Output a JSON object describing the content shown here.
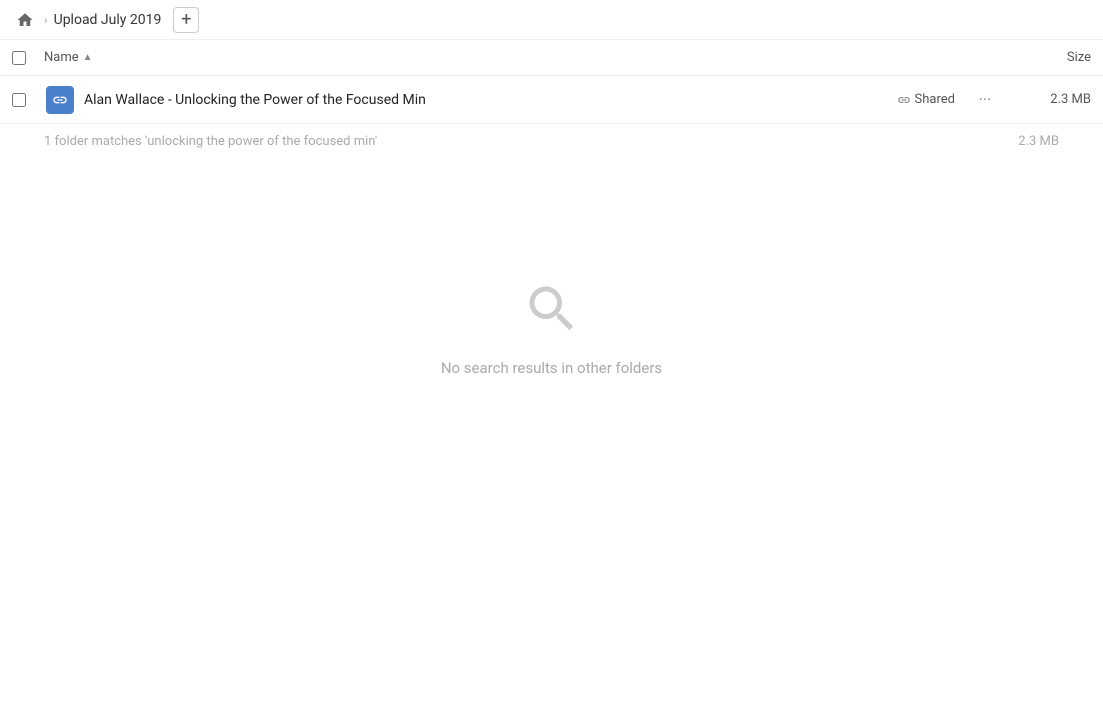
{
  "breadcrumb": {
    "home_label": "Home",
    "current_folder": "Upload July 2019",
    "add_button_label": "+"
  },
  "column_headers": {
    "name_label": "Name",
    "sort_indicator": "▲",
    "size_label": "Size"
  },
  "file_item": {
    "name": "Alan Wallace - Unlocking the Power of the Focused Min",
    "shared_label": "Shared",
    "size": "2.3 MB",
    "icon_type": "folder-shared"
  },
  "match_info": {
    "text": "1 folder matches 'unlocking the power of the focused min'",
    "size": "2.3 MB"
  },
  "empty_state": {
    "icon": "search",
    "message": "No search results in other folders"
  }
}
